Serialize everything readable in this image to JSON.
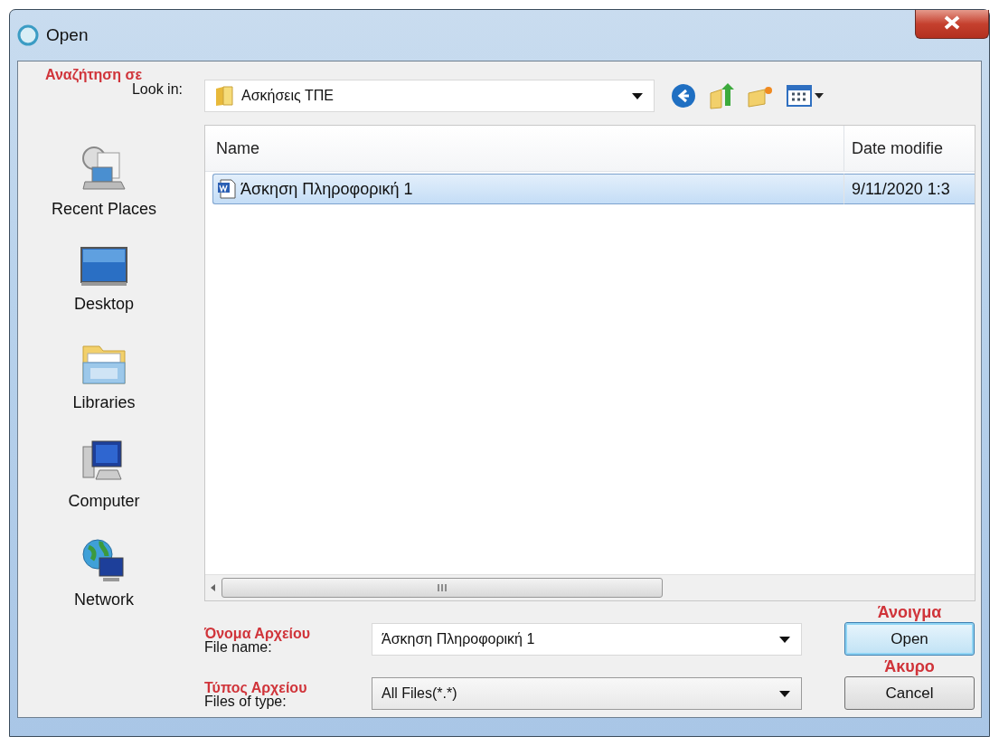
{
  "window": {
    "title": "Open"
  },
  "look_in": {
    "annotation": "Αναζήτηση σε",
    "label": "Look in:",
    "value": "Ασκήσεις ΤΠΕ"
  },
  "places": [
    {
      "kind": "recent",
      "label": "Recent Places",
      "selected": false
    },
    {
      "kind": "desktop",
      "label": "Desktop",
      "selected": false
    },
    {
      "kind": "libraries",
      "label": "Libraries",
      "selected": false
    },
    {
      "kind": "computer",
      "label": "Computer",
      "selected": false
    },
    {
      "kind": "network",
      "label": "Network",
      "selected": false
    }
  ],
  "file_list": {
    "columns": [
      "Name",
      "Date modifie"
    ],
    "rows": [
      {
        "name": "Άσκηση Πληροφορική 1",
        "date": "9/11/2020 1:3",
        "selected": true
      }
    ]
  },
  "file_name": {
    "annotation": "Όνομα Αρχείου",
    "label": "File name:",
    "value": "Άσκηση Πληροφορική 1"
  },
  "file_type": {
    "annotation": "Τύπος Αρχείου",
    "label": "Files of type:",
    "value": "All Files(*.*)"
  },
  "buttons": [
    {
      "annotation": "Άνοιγμα",
      "label": "Open",
      "default": true
    },
    {
      "annotation": "Άκυρο",
      "label": "Cancel",
      "default": false
    }
  ]
}
